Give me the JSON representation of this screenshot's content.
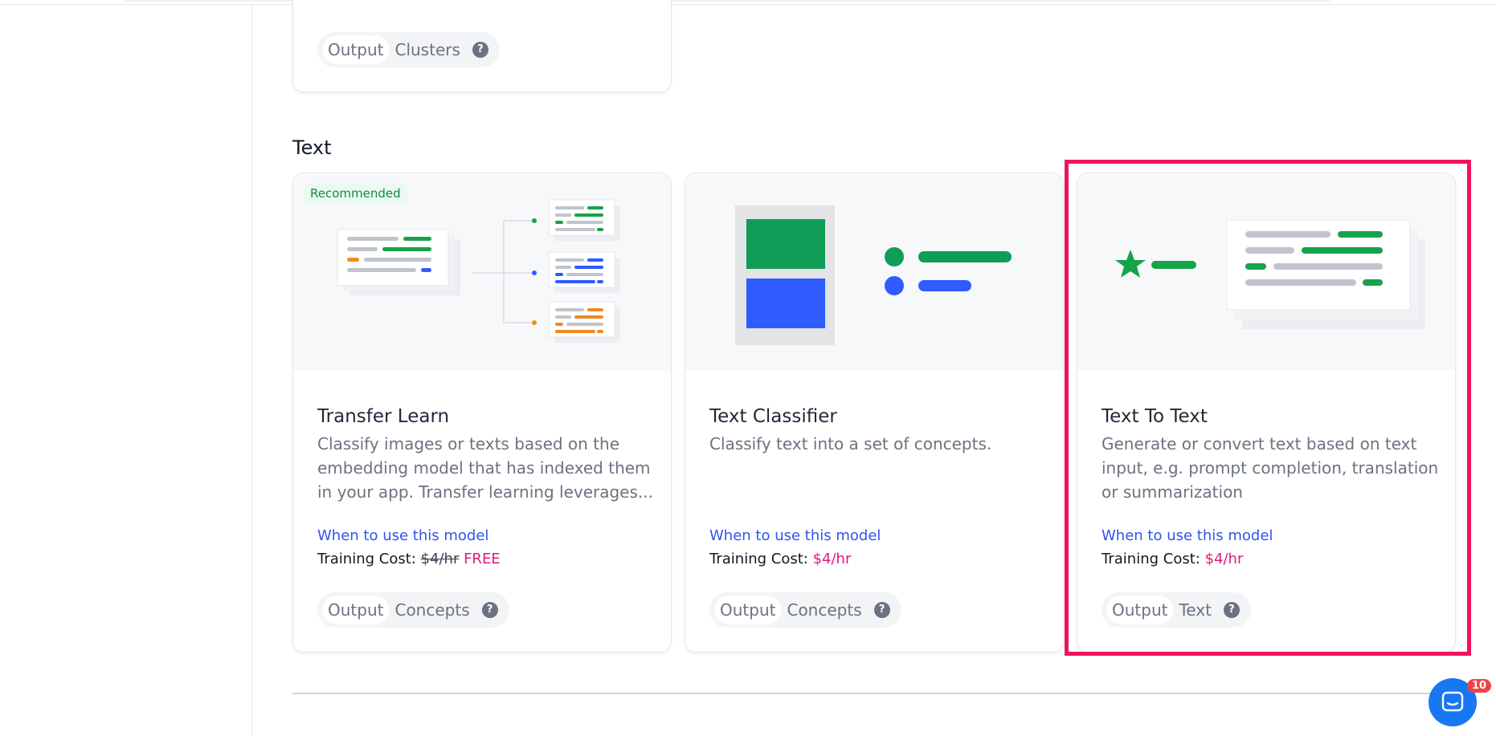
{
  "top_card": {
    "tags": [
      "Output",
      "Clusters"
    ],
    "help": "?"
  },
  "section": {
    "title": "Text"
  },
  "cards": [
    {
      "badge": "Recommended",
      "title": "Transfer Learn",
      "description": "Classify images or texts based on the embedding model that has indexed them in your app. Transfer learning leverages...",
      "link": "When to use this model",
      "cost_label": "Training Cost: ",
      "cost_old": "$4/hr",
      "cost_value": "FREE",
      "tags": [
        "Output",
        "Concepts"
      ],
      "help": "?"
    },
    {
      "title": "Text Classifier",
      "description": "Classify text into a set of concepts.",
      "link": "When to use this model",
      "cost_label": "Training Cost: ",
      "cost_value": "$4/hr",
      "tags": [
        "Output",
        "Concepts"
      ],
      "help": "?"
    },
    {
      "title": "Text To Text",
      "description": "Generate or convert text based on text input, e.g. prompt completion, translation or summarization",
      "link": "When to use this model",
      "cost_label": "Training Cost: ",
      "cost_value": "$4/hr",
      "tags": [
        "Output",
        "Text"
      ],
      "help": "?"
    }
  ],
  "chat": {
    "unread": "10"
  },
  "colors": {
    "accent_link": "#2f54eb",
    "price": "#e0197d",
    "highlight": "#f0145a",
    "green": "#0f9d58",
    "blue": "#2f5bff"
  }
}
